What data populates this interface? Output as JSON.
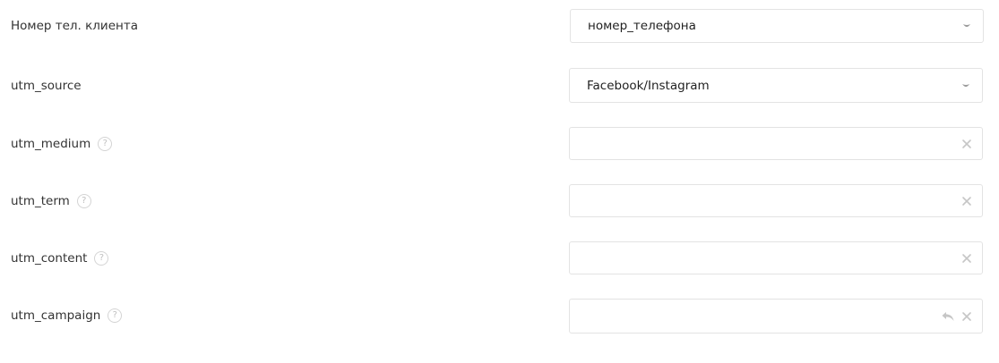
{
  "fields": [
    {
      "label": "Номер тел. клиента",
      "type": "select",
      "value": "номер_телефона",
      "help": false
    },
    {
      "label": "utm_source",
      "type": "select",
      "value": "Facebook/Instagram",
      "help": false
    },
    {
      "label": "utm_medium",
      "type": "input",
      "value": "",
      "help": true
    },
    {
      "label": "utm_term",
      "type": "input",
      "value": "",
      "help": true
    },
    {
      "label": "utm_content",
      "type": "input",
      "value": "",
      "help": true
    },
    {
      "label": "utm_campaign",
      "type": "input",
      "value": "",
      "help": true,
      "undo": true
    }
  ],
  "help_glyph": "?",
  "icons": {
    "select_caret": "chevron-down-icon",
    "clear": "close-icon",
    "undo": "undo-icon"
  },
  "colors": {
    "border": "#e3e3e3",
    "icon": "#c6c6c6",
    "text": "#333333"
  }
}
